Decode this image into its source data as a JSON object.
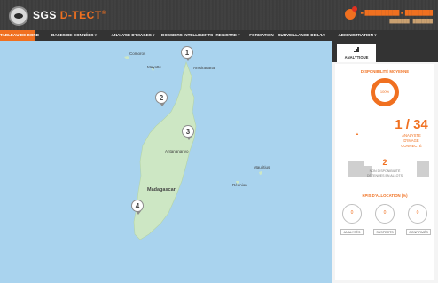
{
  "app": {
    "brand_prefix": "SGS",
    "brand_accent": "D-TECT",
    "brand_mark": "®",
    "user_name": "■ ██████████ ■ ████████",
    "user_role": "███████ · ███████"
  },
  "nav": {
    "items": [
      {
        "label": "TABLEAU DE BORD",
        "active": true
      },
      {
        "label": "BASES DE DONNÉES ▾",
        "active": false
      },
      {
        "label": "ANALYSE D'IMAGES ▾",
        "active": false
      },
      {
        "label": "DOSSIERS INTELLIGENTS",
        "active": false
      },
      {
        "label": "REGISTRE ▾",
        "active": false
      },
      {
        "label": "FORMATION",
        "active": false
      },
      {
        "label": "SURVEILLANCE DE L'IA",
        "active": false
      },
      {
        "label": "ADMINISTRATION ▾",
        "active": false
      }
    ]
  },
  "map": {
    "places": {
      "comoros": "Comoros",
      "mayotte": "Mayotte",
      "antsiranana": "Antsiranana",
      "antananarivo": "Antananarivo",
      "madagascar": "Madagascar",
      "mauritius": "Mauritius",
      "reunion": "Réunion"
    },
    "pins": [
      "1",
      "2",
      "3",
      "4"
    ]
  },
  "panel": {
    "tab_label": "ANALYTIQUE",
    "availability_title": "DISPONIBILITÉ MOYENNE",
    "availability_value": "100%",
    "analysts_count": "1 / 34",
    "analysts_label_1": "ANALYSTE",
    "analysts_label_2": "D'IMAGE",
    "analysts_label_3": "CONNECTÉ",
    "trend_symbol": "▲",
    "vehicles_count": "2",
    "vehicles_label_1": "NON DISPONIBILITÉ",
    "vehicles_label_2": "DÉTENUES EN ALLOTS",
    "kpi_title": "KPIS D'ALLOCATION (%)",
    "kpis": [
      {
        "value": "0",
        "button": "ANALYSÉS"
      },
      {
        "value": "0",
        "button": "SUSPECTS"
      },
      {
        "value": "0",
        "button": "CONFIRMÉS"
      }
    ]
  },
  "colors": {
    "accent": "#f07020",
    "header": "#3b3b3b",
    "nav": "#333333",
    "sea": "#a9d3ee",
    "land": "#cde7c4"
  }
}
